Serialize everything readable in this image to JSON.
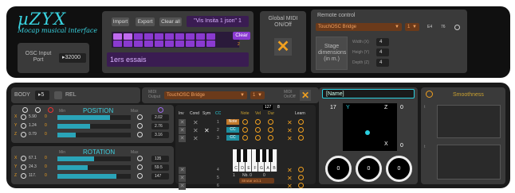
{
  "app": {
    "title": "µZYX",
    "subtitle": "Mocap musical interface"
  },
  "osc": {
    "label": "OSC Input Port",
    "port": "32000"
  },
  "presets": {
    "import": "Import",
    "export": "Export",
    "clear_all": "Clear all",
    "current": "\"Vis Insita 1 json\" 1",
    "clear": "Clear",
    "preset_name": "1ers essais",
    "cells_count": 2
  },
  "midi": {
    "label": "Global MIDI ON/Off"
  },
  "remote": {
    "label": "Remote control",
    "device": "TouchOSC Bridge",
    "channel": "1",
    "e4": "E4",
    "e76": "76"
  },
  "stage": {
    "label": "Stage dimensions (in m.)",
    "width_label": "Width (X)",
    "height_label": "Heigh (Y)",
    "depth_label": "Depth (Z)",
    "width": "4",
    "height": "4",
    "depth": "4"
  },
  "body": {
    "label": "BODY",
    "num": "5",
    "rel": "REL"
  },
  "position": {
    "title": "POSITION",
    "min_label": "Min",
    "max_label": "Max",
    "rows": [
      {
        "axis": "X",
        "value": "5.90",
        "min": "0",
        "max": "2.02",
        "fill": 0.72
      },
      {
        "axis": "Y",
        "value": "1.24",
        "min": "0",
        "max": "2.76",
        "fill": 0.45
      },
      {
        "axis": "Z",
        "value": "0.79",
        "min": "0",
        "max": "3.16",
        "fill": 0.25
      }
    ]
  },
  "rotation": {
    "title": "ROTATION",
    "min_label": "Min",
    "max_label": "Max",
    "rows": [
      {
        "axis": "X",
        "value": "67.1",
        "min": "0",
        "max": "135",
        "fill": 0.5
      },
      {
        "axis": "Y",
        "value": "24.3",
        "min": "0",
        "max": "59.5",
        "fill": 0.41
      },
      {
        "axis": "Z",
        "value": "117.",
        "min": "0",
        "max": "147",
        "fill": 0.8
      }
    ]
  },
  "midi_output": {
    "label": "MIDI Output",
    "device": "TouchOSC Bridge",
    "channel": "1",
    "onoff": "MIDI On/Off"
  },
  "mapping": {
    "headers": [
      "Inv",
      "Cond",
      "Sym",
      "CC",
      "Note",
      "Vel",
      "Dur",
      "Learn"
    ],
    "cc_value": "127",
    "dur_value": "8",
    "rows": [
      {
        "num": "1",
        "type": "Note"
      },
      {
        "num": "2",
        "type": "CC"
      },
      {
        "num": "3",
        "type": "CC"
      },
      {
        "num": "4",
        "type": ""
      },
      {
        "num": "5",
        "type": ""
      },
      {
        "num": "6",
        "type": ""
      }
    ],
    "keys": [
      "C",
      "D",
      "E",
      "F",
      "G",
      "A",
      "B"
    ],
    "oct": "1",
    "range_label": "Nb. 0",
    "scale": "0",
    "free": "Strutar oct.1"
  },
  "name_field": {
    "placeholder": "[Name]"
  },
  "xyz": {
    "n17": "17",
    "y": "Y",
    "z": "Z",
    "z_val": "0",
    "x": "X",
    "x_val": "0",
    "rings": [
      "0",
      "0",
      "0"
    ]
  },
  "smoothness": {
    "label": "Smoothness",
    "t1": "t",
    "t2": "t"
  }
}
